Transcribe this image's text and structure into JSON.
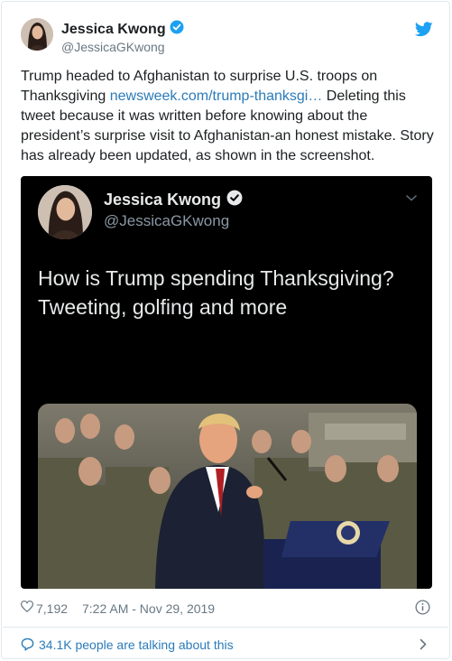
{
  "author": {
    "display_name": "Jessica Kwong",
    "handle": "@JessicaGKwong"
  },
  "tweet": {
    "text_before_link": "Trump headed to Afghanistan to surprise U.S. troops on Thanksgiving ",
    "link_text": "newsweek.com/trump-thanksgi…",
    "text_after_link": " Deleting this tweet because it was written before knowing about the president’s surprise visit to Afghanistan-an honest mistake. Story has already been updated, as shown in the screenshot."
  },
  "embedded": {
    "display_name": "Jessica Kwong",
    "handle": "@JessicaGKwong",
    "text": "How is Trump spending Thanksgiving? Tweeting, golfing and more"
  },
  "meta": {
    "likes": "7,192",
    "timestamp": "7:22 AM - Nov 29, 2019"
  },
  "footer": {
    "talking": "34.1K people are talking about this"
  },
  "colors": {
    "link": "#2b7bb9",
    "verified": "#1da1f2",
    "embedded_bg": "#000000"
  },
  "icons": [
    "verified-badge-icon",
    "twitter-bird-icon",
    "chevron-down-icon",
    "heart-icon",
    "info-icon",
    "speech-bubble-icon",
    "chevron-right-icon"
  ]
}
